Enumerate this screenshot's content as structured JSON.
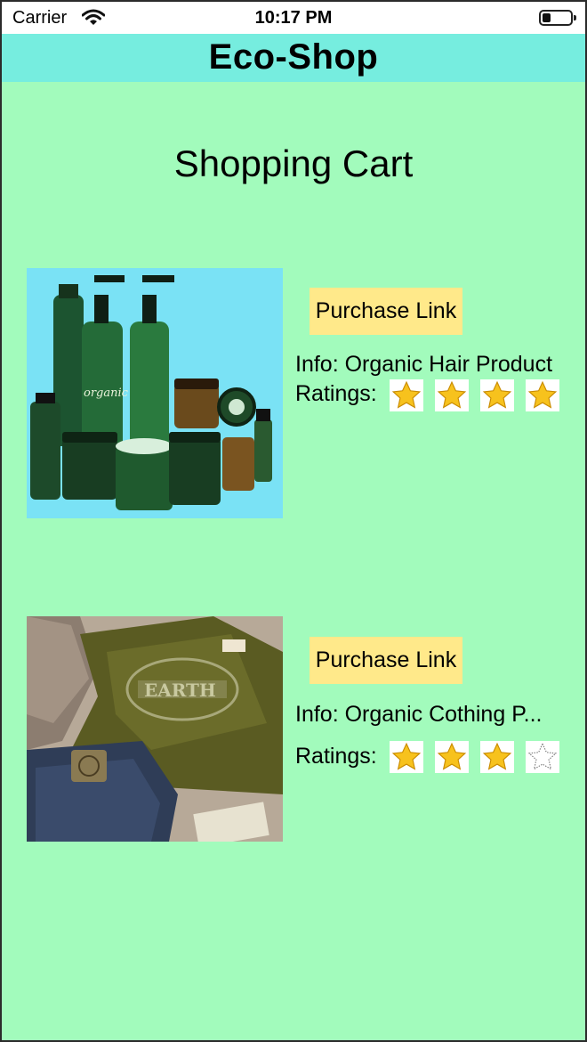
{
  "status_bar": {
    "carrier": "Carrier",
    "time": "10:17 PM",
    "battery_level": 0.3
  },
  "nav": {
    "title": "Eco-Shop"
  },
  "page": {
    "title": "Shopping Cart"
  },
  "products": [
    {
      "image_label": "organic",
      "purchase_label": "Purchase Link",
      "info": "Info: Organic Hair Product",
      "ratings_label": "Ratings:",
      "rating": 4,
      "rating_max": 4
    },
    {
      "image_label": "EARTH",
      "purchase_label": "Purchase Link",
      "info": "Info: Organic Cothing P...",
      "ratings_label": "Ratings:",
      "rating": 3,
      "rating_max": 4
    }
  ],
  "colors": {
    "background": "#a2fbbc",
    "nav_bar": "#76eddf",
    "button": "#ffe98a",
    "star_fill": "#f7c21d"
  },
  "icons": [
    "wifi-icon",
    "battery-icon",
    "star-icon"
  ]
}
